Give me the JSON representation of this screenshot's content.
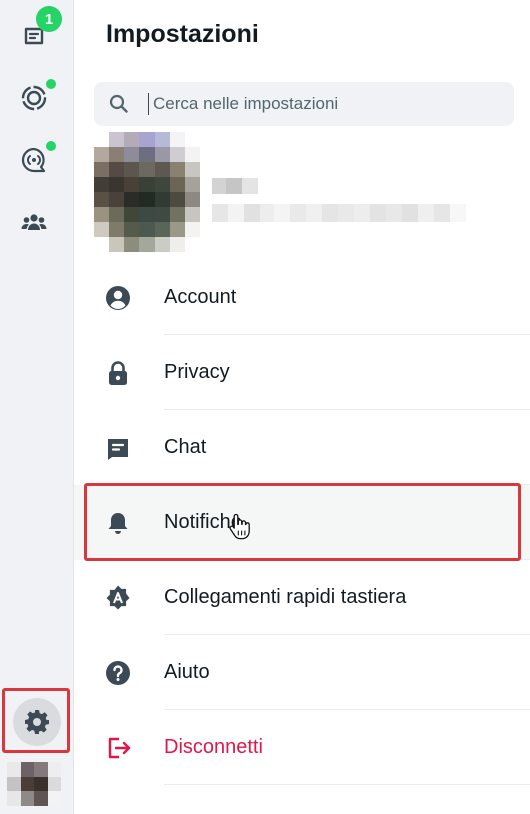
{
  "nav_rail": {
    "chats": {
      "icon": "chats-icon",
      "badge": "1"
    },
    "status": {
      "icon": "status-icon",
      "dot": true
    },
    "channels": {
      "icon": "channels-icon",
      "dot": true
    },
    "communities": {
      "icon": "communities-icon"
    },
    "settings": {
      "icon": "gear-icon",
      "highlighted": true
    },
    "profile": {
      "icon": "profile-avatar"
    }
  },
  "header": {
    "title": "Impostazioni"
  },
  "search": {
    "placeholder": "Cerca nelle impostazioni",
    "value": ""
  },
  "settings_menu": [
    {
      "label": "Account",
      "icon": "account-circle-icon"
    },
    {
      "label": "Privacy",
      "icon": "lock-icon"
    },
    {
      "label": "Chat",
      "icon": "chat-icon"
    },
    {
      "label": "Notifiche",
      "icon": "bell-icon",
      "highlighted": true
    },
    {
      "label": "Collegamenti rapidi tastiera",
      "icon": "keyboard-shortcuts-icon"
    },
    {
      "label": "Aiuto",
      "icon": "help-icon"
    },
    {
      "label": "Disconnetti",
      "icon": "logout-icon",
      "color": "#e0174a"
    }
  ],
  "colors": {
    "accent": "#25d366",
    "highlight_border": "#d9363e",
    "danger": "#e0174a",
    "icon": "#3b4a54"
  }
}
